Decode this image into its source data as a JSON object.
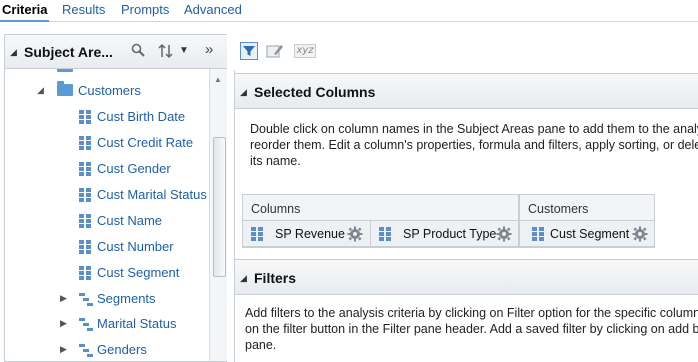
{
  "tabs": [
    {
      "label": "Criteria",
      "active": true
    },
    {
      "label": "Results",
      "active": false
    },
    {
      "label": "Prompts",
      "active": false
    },
    {
      "label": "Advanced",
      "active": false
    }
  ],
  "subject_areas": {
    "title": "Subject Are...",
    "tree": [
      {
        "label": "Customers",
        "type": "folder",
        "expanded": true
      },
      {
        "label": "Cust Birth Date",
        "type": "column"
      },
      {
        "label": "Cust Credit Rate",
        "type": "column"
      },
      {
        "label": "Cust Gender",
        "type": "column"
      },
      {
        "label": "Cust Marital Status",
        "type": "column"
      },
      {
        "label": "Cust Name",
        "type": "column"
      },
      {
        "label": "Cust Number",
        "type": "column"
      },
      {
        "label": "Cust Segment",
        "type": "column"
      },
      {
        "label": "Segments",
        "type": "hierarchy",
        "expanded": false
      },
      {
        "label": "Marital Status",
        "type": "hierarchy",
        "expanded": false
      },
      {
        "label": "Genders",
        "type": "hierarchy",
        "expanded": false
      }
    ]
  },
  "toolbar": {
    "icons": [
      "filter-icon",
      "edit-formula-icon",
      "xyz-icon"
    ],
    "xyz_label": "xyz"
  },
  "selected_columns": {
    "title": "Selected Columns",
    "instructions": [
      "Double click on column names in the Subject Areas pane to add them to the analys",
      "reorder them. Edit a column's properties, formula and filters, apply sorting, or delet",
      "its name."
    ],
    "groups": [
      {
        "title": "Columns",
        "columns": [
          "SP Revenue",
          "SP Product Type"
        ]
      },
      {
        "title": "Customers",
        "columns": [
          "Cust Segment"
        ]
      }
    ]
  },
  "filters": {
    "title": "Filters",
    "instructions": [
      "Add filters to the analysis criteria by clicking on Filter option for the specific column i",
      "on the filter button in the Filter pane header. Add a saved filter by clicking on add but",
      "pane."
    ]
  },
  "colors": {
    "link_blue": "#1f5fa8",
    "icon_blue": "#5b8fc9",
    "folder_blue": "#5b9bd5",
    "border_gray": "#c9ced4"
  }
}
